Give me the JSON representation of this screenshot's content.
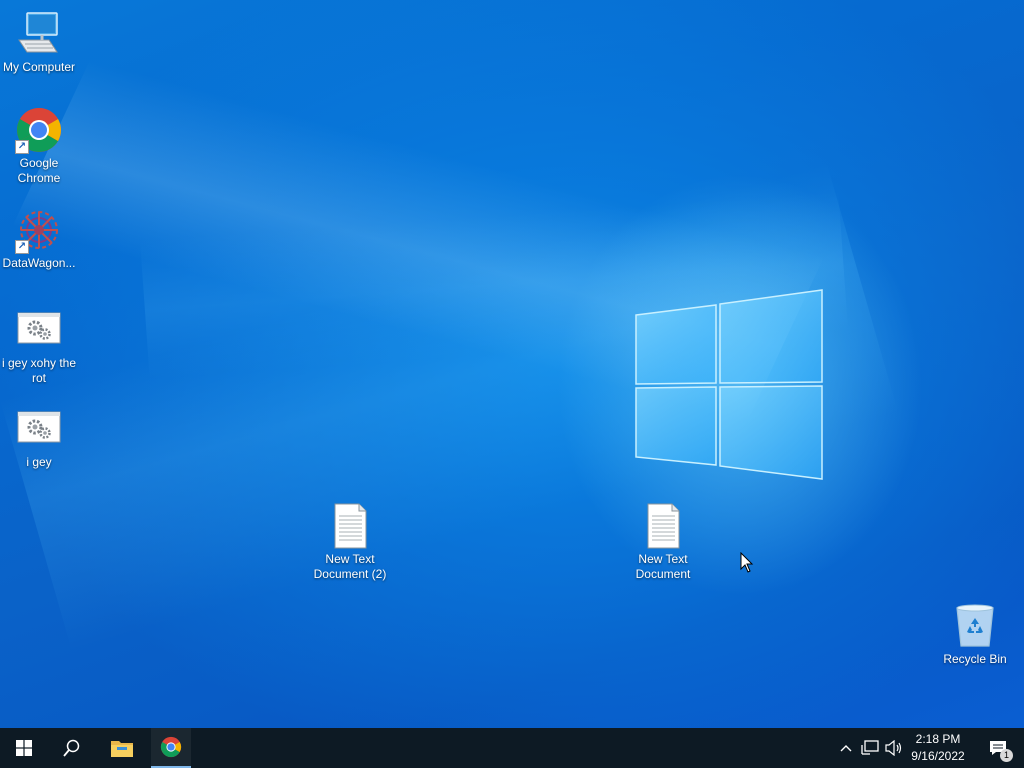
{
  "desktop": {
    "icons": [
      {
        "label": "My Computer",
        "icon": "computer-icon"
      },
      {
        "label": "Google Chrome",
        "icon": "chrome-icon",
        "shortcut": true
      },
      {
        "label": "DataWagon...",
        "icon": "datawagon-icon",
        "shortcut": true
      },
      {
        "label": "i gey xohy the rot",
        "icon": "settings-file-icon"
      },
      {
        "label": "i gey",
        "icon": "settings-file-icon"
      },
      {
        "label": "New Text Document (2)",
        "icon": "text-document-icon"
      },
      {
        "label": "New Text Document",
        "icon": "text-document-icon"
      },
      {
        "label": "Recycle Bin",
        "icon": "recycle-bin-icon"
      }
    ]
  },
  "taskbar": {
    "apps": [
      "start-icon",
      "search-icon",
      "file-explorer-icon",
      "chrome-icon"
    ],
    "tray": [
      "chevron-up-icon",
      "network-icon",
      "volume-icon"
    ],
    "clock": {
      "time": "2:18 PM",
      "date": "9/16/2022"
    },
    "notifications": {
      "count": "1"
    }
  },
  "colors": {
    "taskbar_bg": "#0d1a24",
    "active_app_indicator": "#7fb7ea",
    "desktop_blue": "#0a6fd6"
  }
}
